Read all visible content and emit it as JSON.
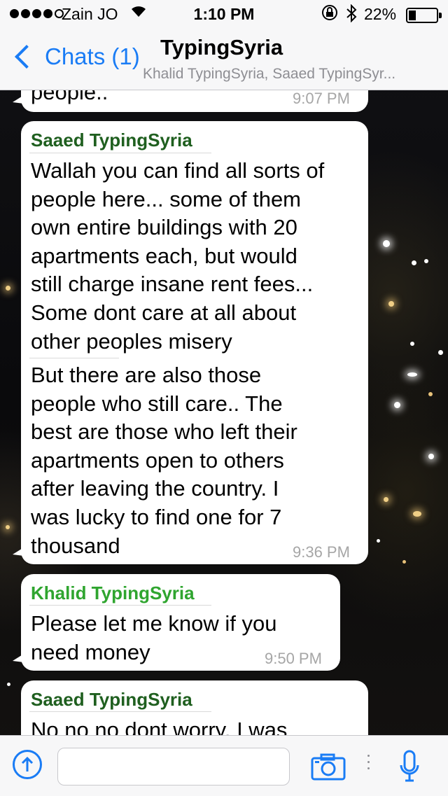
{
  "status_bar": {
    "carrier": "Zain JO",
    "time": "1:10 PM",
    "battery": "22%",
    "battery_level": 0.22,
    "signal_bars_filled": 4,
    "signal_bars_total": 5
  },
  "nav": {
    "back_label": "Chats (1)",
    "title": "TypingSyria",
    "subtitle": "Khalid TypingSyria, Saaed TypingSyr..."
  },
  "messages": [
    {
      "text": "people..",
      "time": "9:07 PM"
    },
    {
      "sender": "Saaed TypingSyria",
      "paragraph1": "Wallah you can find all sorts of\npeople here... some of them\nown entire buildings with 20\napartments each, but would\nstill charge insane rent fees...\nSome dont care at all about\nother peoples misery",
      "paragraph2": "But there are also those\npeople who still care.. The\nbest are those who left their\napartments open to others\nafter leaving the country.  I\nwas lucky to find one for 7\nthousand",
      "time": "9:36 PM"
    },
    {
      "sender": "Khalid TypingSyria",
      "text": "Please let me know if you\nneed money",
      "time": "9:50 PM"
    },
    {
      "sender": "Saaed TypingSyria",
      "text": "No no no dont worry. I was"
    }
  ],
  "colors": {
    "accent": "#1a7cf5",
    "sender_saaed": "#1f5f1f",
    "sender_khalid": "#2fa52f",
    "timestamp": "#a6a6a6"
  },
  "input": {
    "placeholder": "",
    "share_icon": "share-arrow-icon",
    "camera_icon": "camera-icon",
    "mic_icon": "microphone-icon"
  }
}
